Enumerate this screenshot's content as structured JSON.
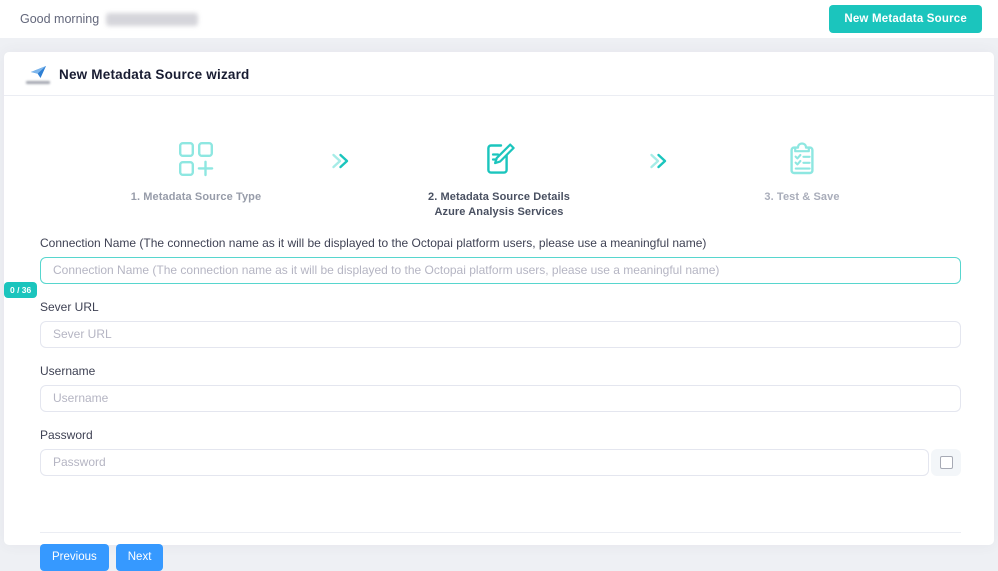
{
  "theme": {
    "teal": "#1BC5BD",
    "teal_light": "#8EE7E1",
    "blue": "#3699FF",
    "page_background": "#eef0f4",
    "input_border": "#E4E6EF",
    "focus_border": "#57d6ce"
  },
  "header": {
    "greeting": "Good morning",
    "new_source_button_label": "New Metadata Source"
  },
  "wizard": {
    "title": "New Metadata Source wizard",
    "steps": [
      {
        "label": "1. Metadata Source Type",
        "icon": "grid-plus-icon",
        "state": "upcoming"
      },
      {
        "label": "2. Metadata Source Details",
        "sublabel": "Azure Analysis Services",
        "icon": "edit-document-icon",
        "state": "active"
      },
      {
        "label": "3. Test & Save",
        "icon": "clipboard-check-icon",
        "state": "upcoming"
      }
    ]
  },
  "form": {
    "connection_name": {
      "label": "Connection Name (The connection name as it will be displayed to the Octopai platform users, please use a meaningful name)",
      "placeholder": "Connection Name (The connection name as it will be displayed to the Octopai platform users, please use a meaningful name)",
      "value": "",
      "char_counter": "0 / 36"
    },
    "server_url": {
      "label": "Sever URL",
      "placeholder": "Sever URL",
      "value": ""
    },
    "username": {
      "label": "Username",
      "placeholder": "Username",
      "value": ""
    },
    "password": {
      "label": "Password",
      "placeholder": "Password",
      "value": "",
      "show_password_checked": false
    }
  },
  "actions": {
    "previous_label": "Previous",
    "next_label": "Next"
  }
}
